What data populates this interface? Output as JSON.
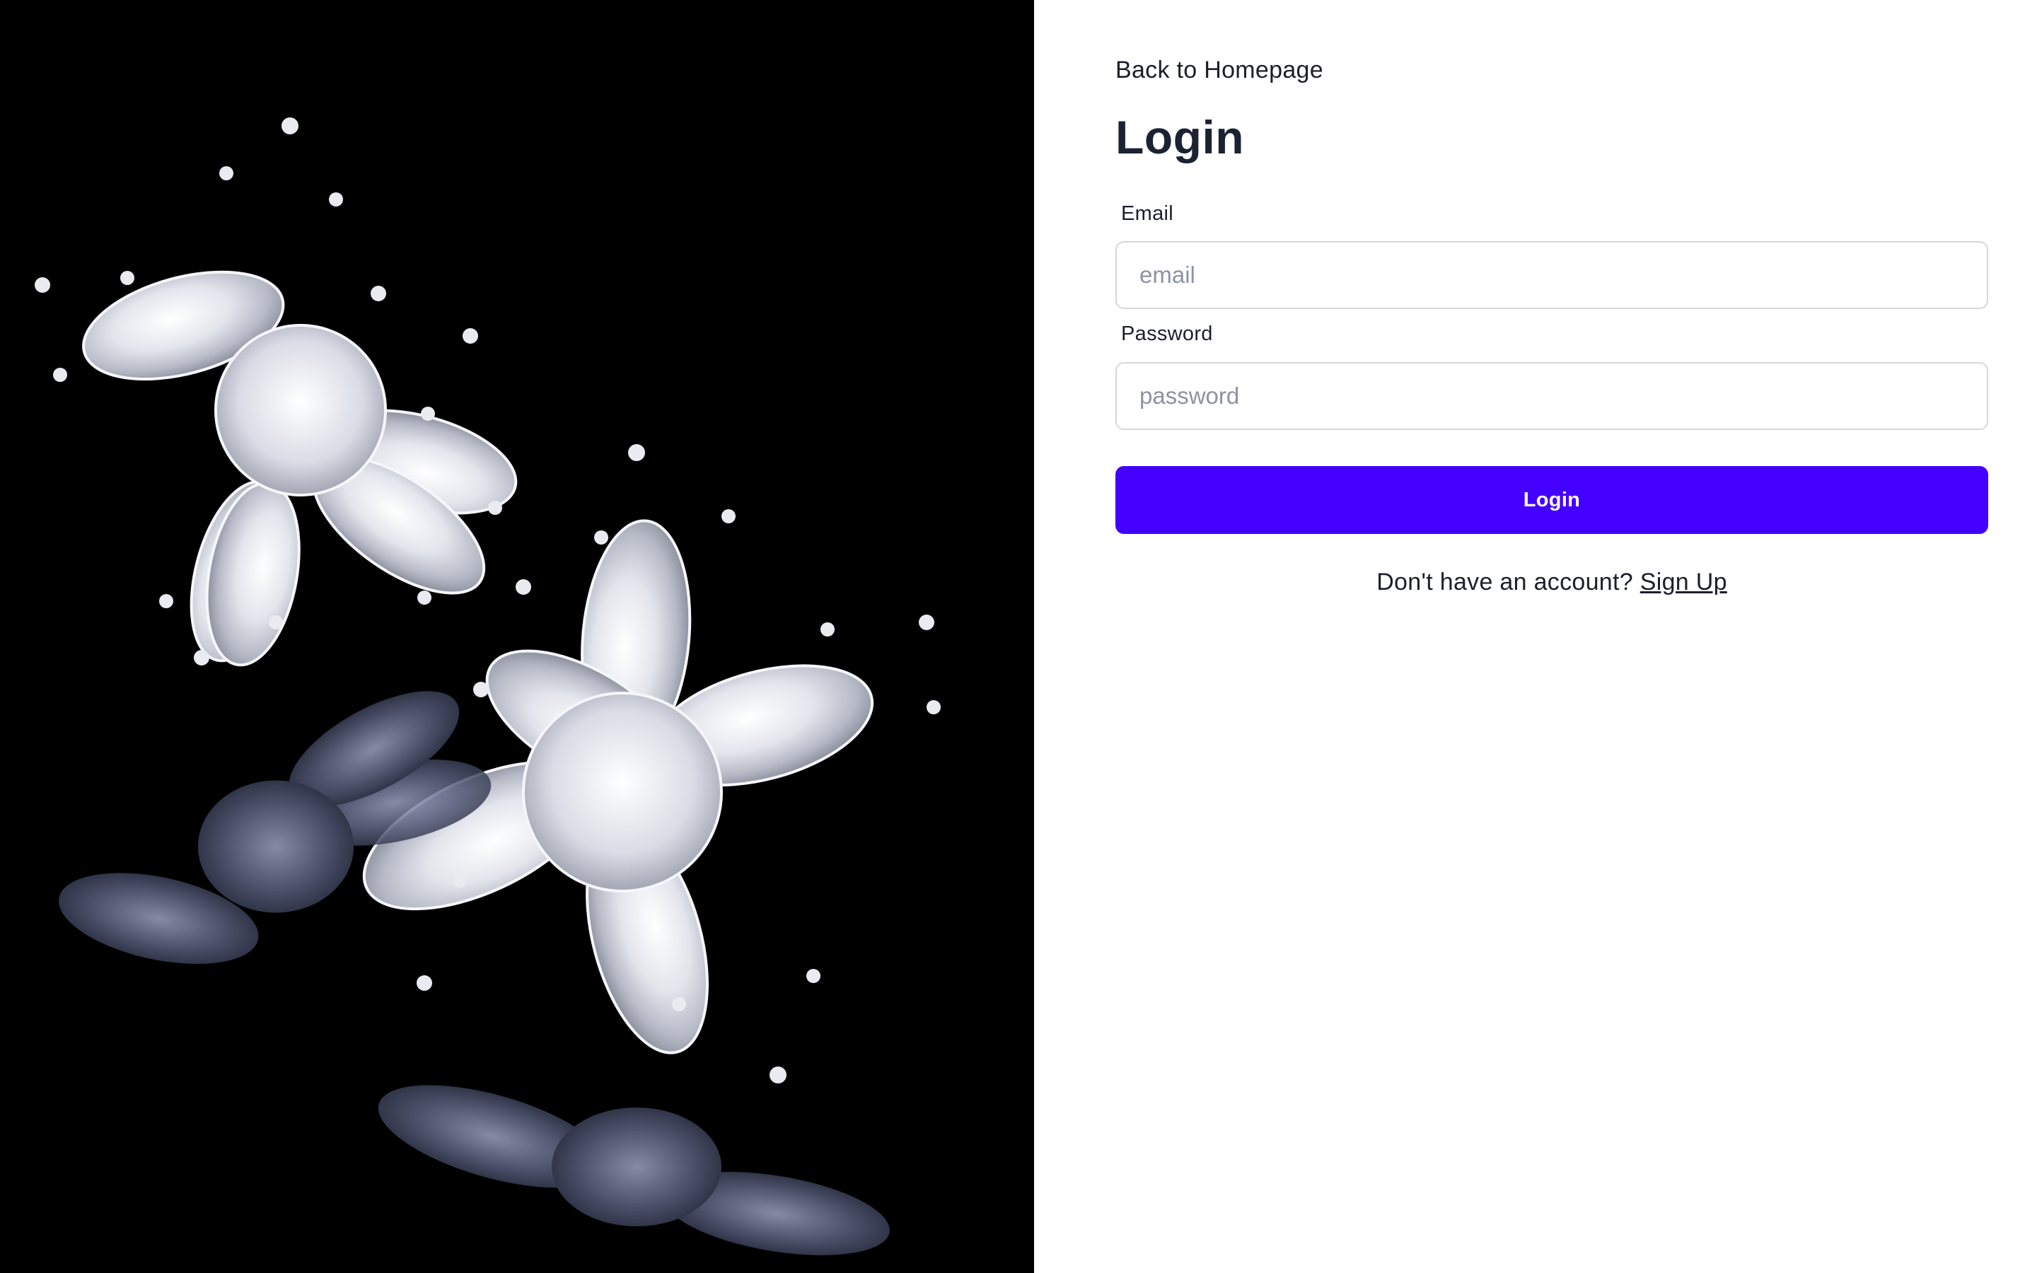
{
  "hero": {
    "image": "diamond-earrings-photo",
    "background": "#000000"
  },
  "nav": {
    "back_label": "Back to Homepage"
  },
  "form": {
    "title": "Login",
    "email": {
      "label": "Email",
      "placeholder": "email",
      "value": ""
    },
    "password": {
      "label": "Password",
      "placeholder": "password",
      "value": ""
    },
    "submit_label": "Login",
    "signup_prompt": "Don't have an account?",
    "signup_link": "Sign Up"
  },
  "colors": {
    "accent": "#4400ff",
    "text": "#1c1f2a",
    "title": "#1b2232",
    "input_border": "#d6d8de",
    "placeholder": "#8c93a1"
  }
}
